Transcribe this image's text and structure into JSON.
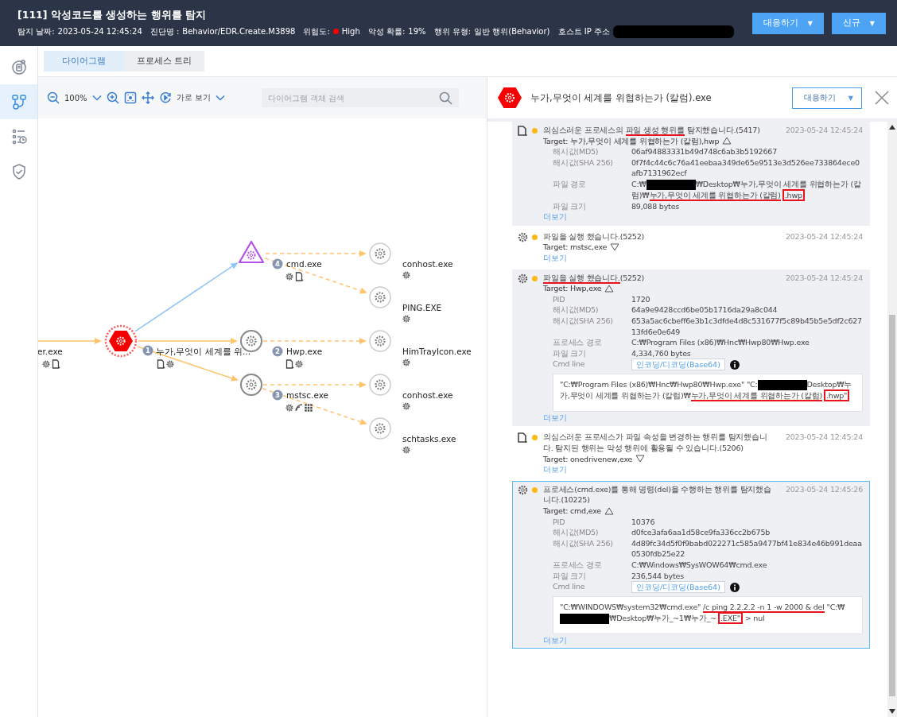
{
  "header": {
    "title": "[111] 악성코드를 생성하는 행위를 탐지",
    "meta": [
      {
        "label": "탐지 날짜:",
        "value": "2023-05-24 12:45:24"
      },
      {
        "label": "진단명 :",
        "value": "Behavior/EDR.Create.M3898"
      },
      {
        "label": "위험도:",
        "value": "High",
        "color": "#ff0000"
      },
      {
        "label": "악성 확률:",
        "value": "19%"
      },
      {
        "label": "행위 유형:",
        "value": "일반 행위(Behavior)"
      },
      {
        "label": "호스트 IP 주소",
        "redacted": true
      }
    ],
    "buttons": [
      {
        "label": "대응하기",
        "caret": "▼"
      },
      {
        "label": "신규",
        "caret": "▼"
      }
    ]
  },
  "rail": [
    {
      "kind": "report",
      "selected": false
    },
    {
      "kind": "diagram",
      "selected": true
    },
    {
      "kind": "timeline",
      "selected": false
    },
    {
      "kind": "shield",
      "selected": false
    }
  ],
  "tabs": [
    {
      "label": "다이어그램",
      "selected": true
    },
    {
      "label": "프로세스 트리",
      "selected": false
    }
  ],
  "toolbar": {
    "zoom": "100%",
    "view": "가로 보기",
    "search_placeholder": "다이어그램 객체 검색"
  },
  "diagram": {
    "nodes": [
      {
        "label": "er.exe",
        "kind": "partial"
      },
      {
        "label": "누가,무엇이 세계를 위...",
        "badge": "1",
        "kind": "malicious"
      },
      {
        "label": "cmd.exe",
        "badge": "4",
        "kind": "suspicious"
      },
      {
        "label": "Hwp.exe",
        "badge": "2",
        "kind": "process"
      },
      {
        "label": "mstsc.exe",
        "badge": "3",
        "kind": "process"
      },
      {
        "label": "conhost.exe",
        "kind": "child"
      },
      {
        "label": "PING.EXE",
        "kind": "child"
      },
      {
        "label": "HimTrayIcon.exe",
        "kind": "child"
      },
      {
        "label": "conhost.exe",
        "kind": "child"
      },
      {
        "label": "schtasks.exe",
        "kind": "child"
      }
    ]
  },
  "detail_panel": {
    "title": "누가,무엇이 세계를 위협하는가 (칼럼).exe",
    "action": {
      "label": "대응하기",
      "caret": "▼"
    },
    "events": [
      {
        "kind": "file",
        "title": [
          {
            "text": "의심스러운 프로세스의 ",
            "kind": "plain"
          },
          {
            "text": "파일 생성 행위를",
            "kind": "underline"
          },
          {
            "text": " 탐지했습니다.(5417)",
            "kind": "plain"
          }
        ],
        "time": "2023-05-24 12:45:24",
        "target": "Target: 누가,무엇이 세계를 위협하는가 (칼럼),hwp",
        "expanded": true,
        "selected": false,
        "details": [
          {
            "label": "해시값(MD5)",
            "value": [
              {
                "text": "06af94883331b49d748c6ab3b5192667",
                "kind": "plain"
              }
            ]
          },
          {
            "label": "해시값(SHA 256)",
            "value": [
              {
                "text": "0f7f4c44c6c76a41eebaa349de65e9513e3d526ee733864ece0afb7131962ecf",
                "kind": "plain"
              }
            ]
          },
          {
            "label": "파일 경로",
            "value": [
              {
                "text": "C:₩",
                "kind": "plain"
              },
              {
                "kind": "redacted"
              },
              {
                "text": "₩Desktop₩누가,무엇이 세계를 위협하는가 (칼럼)₩",
                "kind": "plain"
              },
              {
                "text": "누가,무엇이 세계를 위협하는가 (칼럼)",
                "kind": "underline"
              },
              {
                "text": ".hwp",
                "kind": "box"
              }
            ]
          },
          {
            "label": "파일 크기",
            "value": [
              {
                "text": "89,088 bytes",
                "kind": "plain"
              }
            ]
          }
        ],
        "more": "더보기"
      },
      {
        "kind": "gear",
        "title": [
          {
            "text": "파일을 실행 했습니다.(5252)",
            "kind": "plain"
          }
        ],
        "time": "2023-05-24 12:45:24",
        "target": "Target: mstsc,exe",
        "expanded": false,
        "selected": false,
        "more": "더보기"
      },
      {
        "kind": "gear",
        "title": [
          {
            "text": "파일을 실행 했습니다.",
            "kind": "underline"
          },
          {
            "text": "(5252)",
            "kind": "plain"
          }
        ],
        "time": "2023-05-24 12:45:24",
        "target": "Target: Hwp,exe",
        "expanded": true,
        "selected": false,
        "details": [
          {
            "label": "PID",
            "value": [
              {
                "text": "1720",
                "kind": "plain"
              }
            ]
          },
          {
            "label": "해시값(MD5)",
            "value": [
              {
                "text": "64a9e9428ccd6be05b1716da29a8c044",
                "kind": "plain"
              }
            ]
          },
          {
            "label": "해시값(SHA 256)",
            "value": [
              {
                "text": "653a5ac6cbeff6e3b1c3dfde4d8c531677f5c89b45b5e5df2c62713fd6e0e649",
                "kind": "plain"
              }
            ]
          },
          {
            "label": "프로세스 경로",
            "value": [
              {
                "text": "C:₩Program Files (x86)₩Hnc₩Hwp80₩Hwp.exe",
                "kind": "plain"
              }
            ]
          },
          {
            "label": "파일 크기",
            "value": [
              {
                "text": "4,334,760 bytes",
                "kind": "plain"
              }
            ]
          }
        ],
        "cmd_line": {
          "label": "Cmd line",
          "button": "인코딩/디코딩(Base64)",
          "text": [
            {
              "text": "\"C:₩Program Files (x86)₩Hnc₩Hwp80₩Hwp.exe\" \"C:",
              "kind": "plain"
            },
            {
              "kind": "redacted"
            },
            {
              "text": "Desktop₩누가,무엇이 세계를 위협하는가 (칼럼)₩",
              "kind": "plain"
            },
            {
              "text": "누가,무엇이 세계를 위협하는가 (칼럼)",
              "kind": "underline"
            },
            {
              "text": ".hwp\"",
              "kind": "box"
            }
          ]
        },
        "more": "더보기"
      },
      {
        "kind": "file",
        "title": [
          {
            "text": "의심스러운 프로세스가 파일 속성을 변경하는 행위를 탐지했습니다. 탐지된 행위는 악성 행위에 활용될 수 있습니다.(5206)",
            "kind": "plain"
          }
        ],
        "time": "2023-05-24 12:45:24",
        "target": "Target: onedrivenew,exe",
        "expanded": false,
        "selected": false,
        "more": "더보기"
      },
      {
        "kind": "gear",
        "title": [
          {
            "text": "프로세스(cmd.exe)를 통해 명령(del)을 수행하는 행위를 탐지했습니다.(10225)",
            "kind": "plain"
          }
        ],
        "time": "2023-05-24 12:45:26",
        "target": "Target: cmd,exe",
        "expanded": true,
        "selected": true,
        "details": [
          {
            "label": "PID",
            "value": [
              {
                "text": "10376",
                "kind": "plain"
              }
            ]
          },
          {
            "label": "해시값(MD5)",
            "value": [
              {
                "text": "d0fce3afa6aa1d58ce9fa336cc2b675b",
                "kind": "plain"
              }
            ]
          },
          {
            "label": "해시값(SHA 256)",
            "value": [
              {
                "text": "4d89fc34d5f0f9babd022271c585a9477bf41e834e46b991deaa0530fdb25e22",
                "kind": "plain"
              }
            ]
          },
          {
            "label": "프로세스 경로",
            "value": [
              {
                "text": "C:₩Windows₩SysWOW64₩cmd.exe",
                "kind": "plain"
              }
            ]
          },
          {
            "label": "파일 크기",
            "value": [
              {
                "text": "236,544 bytes",
                "kind": "plain"
              }
            ]
          }
        ],
        "cmd_line": {
          "label": "Cmd line",
          "button": "인코딩/디코딩(Base64)",
          "text": [
            {
              "text": "\"C:₩WINDOWS₩system32₩cmd.exe\" ",
              "kind": "plain"
            },
            {
              "text": "/c ping 2.2.2.2 -n 1 -w 2000 & del",
              "kind": "underline"
            },
            {
              "text": " \"C:₩",
              "kind": "plain"
            },
            {
              "kind": "redacted"
            },
            {
              "text": "₩Desktop₩누가_~1₩누가_~",
              "kind": "plain"
            },
            {
              "text": ".EXE\"",
              "kind": "box"
            },
            {
              "text": " > nul",
              "kind": "plain"
            }
          ]
        },
        "more": "더보기"
      }
    ]
  }
}
